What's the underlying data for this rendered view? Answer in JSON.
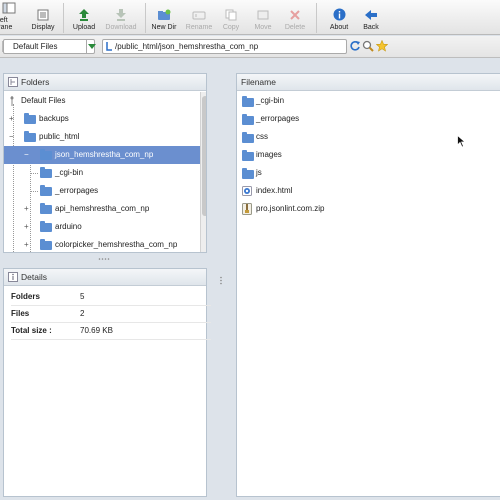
{
  "toolbar": {
    "buttons": [
      {
        "label": "Left Pane",
        "icon": "left-pane-icon",
        "enabled": true
      },
      {
        "label": "Display",
        "icon": "display-icon",
        "enabled": true
      },
      {
        "label": "Upload",
        "icon": "upload-icon",
        "enabled": true
      },
      {
        "label": "Download",
        "icon": "download-icon",
        "enabled": false
      },
      {
        "label": "New Dir",
        "icon": "new-dir-icon",
        "enabled": true
      },
      {
        "label": "Rename",
        "icon": "rename-icon",
        "enabled": false
      },
      {
        "label": "Copy",
        "icon": "copy-icon",
        "enabled": false
      },
      {
        "label": "Move",
        "icon": "move-icon",
        "enabled": false
      },
      {
        "label": "Delete",
        "icon": "delete-icon",
        "enabled": false
      },
      {
        "label": "About",
        "icon": "about-icon",
        "enabled": true
      },
      {
        "label": "Back",
        "icon": "back-icon",
        "enabled": true
      }
    ]
  },
  "address": {
    "location_select": "Default Files",
    "path": "/public_html/json_hemshrestha_com_np"
  },
  "folders_panel": {
    "title": "Folders",
    "items": [
      {
        "label": "Default Files"
      },
      {
        "label": "backups"
      },
      {
        "label": "public_html"
      },
      {
        "label": "json_hemshrestha_com_np",
        "selected": true
      },
      {
        "label": "_cgi-bin"
      },
      {
        "label": "_errorpages"
      },
      {
        "label": "api_hemshrestha_com_np"
      },
      {
        "label": "arduino"
      },
      {
        "label": "colorpicker_hemshrestha_com_np"
      }
    ]
  },
  "details_panel": {
    "title": "Details",
    "rows": [
      {
        "key": "Folders",
        "value": "5"
      },
      {
        "key": "Files",
        "value": "2"
      },
      {
        "key": "Total size :",
        "value": "70.69 KB"
      }
    ]
  },
  "files_panel": {
    "column_header": "Filename",
    "files": [
      {
        "name": "_cgi-bin",
        "type": "folder"
      },
      {
        "name": "_errorpages",
        "type": "folder"
      },
      {
        "name": "css",
        "type": "folder"
      },
      {
        "name": "images",
        "type": "folder"
      },
      {
        "name": "js",
        "type": "folder"
      },
      {
        "name": "index.html",
        "type": "html"
      },
      {
        "name": "pro.jsonlint.com.zip",
        "type": "zip"
      }
    ]
  },
  "colors": {
    "selection": "#6b8fcf",
    "folder_icon": "#5b8ed2",
    "background": "#dde3ea"
  }
}
